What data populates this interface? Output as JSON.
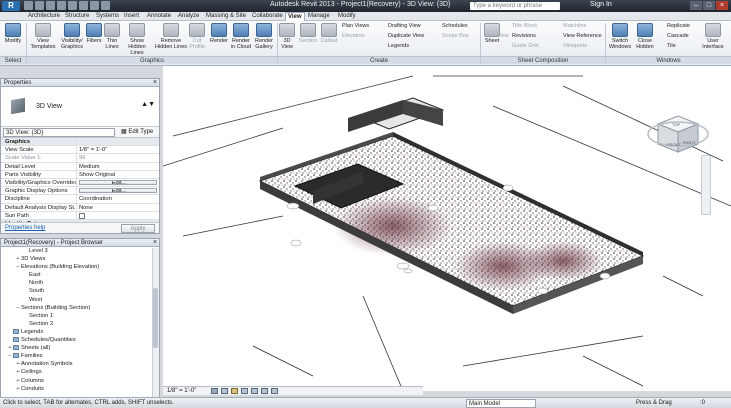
{
  "window": {
    "title": "Autodesk Revit 2013 -  Project1(Recovery) - 3D View: {3D}",
    "search_placeholder": "Type a keyword or phrase",
    "signin": "Sign In",
    "app_button": "R"
  },
  "tabs": [
    "Architecture",
    "Structure",
    "Systems",
    "Insert",
    "Annotate",
    "Analyze",
    "Massing & Site",
    "Collaborate",
    "View",
    "Manage",
    "Modify"
  ],
  "active_tab": "View",
  "ribbon": {
    "select": {
      "modify": "Modify",
      "panel": "Select"
    },
    "graphics": {
      "view_templates": "View Templates",
      "visibility_graphics": "Visibility/ Graphics",
      "filters": "Filters",
      "thin_lines": "Thin Lines",
      "show_hidden_lines": "Show Hidden Lines",
      "remove_hidden_lines": "Remove Hidden Lines",
      "cut_profile": "Cut Profile",
      "render": "Render",
      "render_in_cloud": "Render in Cloud",
      "render_gallery": "Render Gallery",
      "panel": "Graphics"
    },
    "create": {
      "view_3d": "3D View",
      "section": "Section",
      "callout": "Callout",
      "plan_views": "Plan Views",
      "elevation": "Elevation",
      "drafting_view": "Drafting View",
      "duplicate_view": "Duplicate View",
      "legends": "Legends",
      "schedules": "Schedules",
      "scope_box": "Scope Box",
      "panel": "Create"
    },
    "sheet": {
      "sheet": "Sheet",
      "title_block": "Title Block",
      "matchline": "Matchline",
      "view": "View",
      "revisions": "Revisions",
      "view_reference": "View Reference",
      "guide_grid": "Guide Grid",
      "viewports": "Viewports",
      "panel": "Sheet Composition"
    },
    "windows": {
      "switch_windows": "Switch Windows",
      "close_hidden": "Close Hidden",
      "replicate": "Replicate",
      "cascade": "Cascade",
      "tile": "Tile",
      "user_interface": "User Interface",
      "panel": "Windows"
    }
  },
  "properties": {
    "title": "Properties",
    "type_name": "3D View",
    "instance_selector": "3D View: {3D}",
    "edit_type": "Edit Type",
    "rows": [
      {
        "k": "Graphics",
        "v": "",
        "kind": "grp"
      },
      {
        "k": "View Scale",
        "v": "1/8\" = 1'-0\"",
        "kind": "field"
      },
      {
        "k": "Scale Value    1:",
        "v": "96",
        "kind": "dim"
      },
      {
        "k": "Detail Level",
        "v": "Medium",
        "kind": "field"
      },
      {
        "k": "Parts Visibility",
        "v": "Show Original",
        "kind": "field"
      },
      {
        "k": "Visibility/Graphics Overrides",
        "v": "Edit...",
        "kind": "btn"
      },
      {
        "k": "Graphic Display Options",
        "v": "Edit...",
        "kind": "btn"
      },
      {
        "k": "Discipline",
        "v": "Coordination",
        "kind": "field"
      },
      {
        "k": "Default Analysis Display St...",
        "v": "None",
        "kind": "field"
      },
      {
        "k": "Sun Path",
        "v": "",
        "kind": "check"
      },
      {
        "k": "Identity Data",
        "v": "",
        "kind": "grp"
      }
    ],
    "help": "Properties help",
    "apply": "Apply"
  },
  "browser": {
    "title": "Project1(Recovery) - Project Browser",
    "items": [
      {
        "label": "Level 3",
        "level": 2,
        "toggle": ""
      },
      {
        "label": "3D Views",
        "level": 1,
        "toggle": "+"
      },
      {
        "label": "Elevations (Building Elevation)",
        "level": 1,
        "toggle": "−"
      },
      {
        "label": "East",
        "level": 2,
        "toggle": ""
      },
      {
        "label": "North",
        "level": 2,
        "toggle": ""
      },
      {
        "label": "South",
        "level": 2,
        "toggle": ""
      },
      {
        "label": "West",
        "level": 2,
        "toggle": ""
      },
      {
        "label": "Sections (Building Section)",
        "level": 1,
        "toggle": "−"
      },
      {
        "label": "Section 1",
        "level": 2,
        "toggle": ""
      },
      {
        "label": "Section 2",
        "level": 2,
        "toggle": ""
      },
      {
        "label": "Legends",
        "level": 0,
        "toggle": ""
      },
      {
        "label": "Schedules/Quantities",
        "level": 0,
        "toggle": ""
      },
      {
        "label": "Sheets (all)",
        "level": 0,
        "toggle": "+"
      },
      {
        "label": "Families",
        "level": 0,
        "toggle": "−"
      },
      {
        "label": "Annotation Symbols",
        "level": 1,
        "toggle": "+"
      },
      {
        "label": "Ceilings",
        "level": 1,
        "toggle": "+"
      },
      {
        "label": "Columns",
        "level": 1,
        "toggle": "+"
      },
      {
        "label": "Conduits",
        "level": 1,
        "toggle": "+"
      }
    ]
  },
  "view_control_bar": {
    "scale": "1/8\" = 1'-0\""
  },
  "viewcube": {
    "top": "TOP",
    "front": "FRONT",
    "right": "RIGHT"
  },
  "status": {
    "text": "Click to select, TAB for alternates, CTRL adds, SHIFT unselects.",
    "model": "Main Model",
    "press_drag": "Press & Drag",
    "filter_count": ":0"
  }
}
